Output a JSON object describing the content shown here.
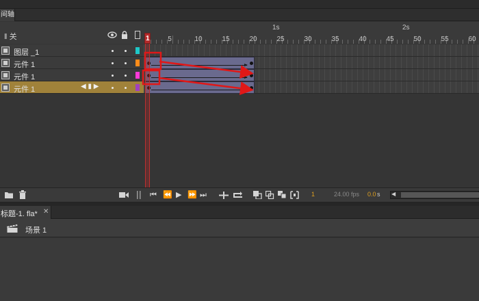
{
  "panel": {
    "tab_label": "间轴"
  },
  "layer_header": {
    "label": "‖ 关"
  },
  "ruler": {
    "seconds": [
      "1s",
      "2s"
    ],
    "frame_numbers": [
      "5",
      "10",
      "15",
      "20",
      "25",
      "30",
      "35",
      "40",
      "45",
      "50",
      "55",
      "60"
    ],
    "current_frame": "1"
  },
  "layers": [
    {
      "name": "图层 _1",
      "color": "#1ec8c8",
      "selected": false,
      "has_tween": false
    },
    {
      "name": "元件 1",
      "color": "#ff8c1a",
      "selected": false,
      "has_tween": true
    },
    {
      "name": "元件 1",
      "color": "#ff3ad8",
      "selected": false,
      "has_tween": true
    },
    {
      "name": "元件 1",
      "color": "#a040c0",
      "selected": true,
      "has_tween": true
    }
  ],
  "row_arrows": "◀ ▮ ▶",
  "toolbar": {
    "frame_number": "1",
    "fps": "24.00 fps",
    "elapsed": "0.0",
    "elapsed_unit": "s"
  },
  "document": {
    "tab_label": "标题-1. fla*",
    "close_glyph": "✕"
  },
  "scene": {
    "label": "场景 1"
  },
  "colors": {
    "accent_selected": "#a0823a",
    "tween": "#6a6a8e",
    "playhead": "#c03030",
    "annotation": "#e01818"
  }
}
